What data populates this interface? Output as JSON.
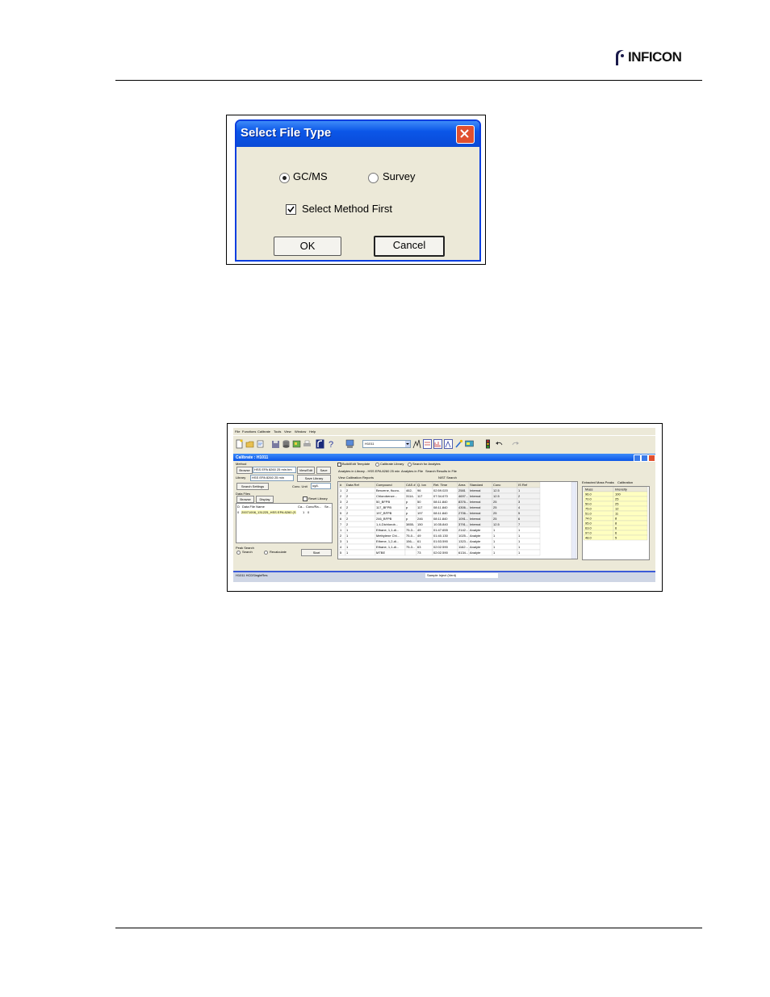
{
  "header": {
    "logo_text": "INFICON"
  },
  "select_file_type_dialog": {
    "title": "Select File Type",
    "options": [
      {
        "label": "GC/MS",
        "selected": true
      },
      {
        "label": "Survey",
        "selected": false
      }
    ],
    "checkbox": {
      "label": "Select Method First",
      "checked": true
    },
    "ok_label": "OK",
    "cancel_label": "Cancel"
  },
  "calibrate_window": {
    "menu": [
      "File",
      "Functions",
      "Calibrate",
      "Tools",
      "View",
      "Window",
      "Help"
    ],
    "toolbar_combo": "H1011",
    "title": "Calibrate : H1011",
    "method_label": "Method",
    "browse_label": "Browse",
    "method_value": "HSS EPA 8260 25 min.hm",
    "view_edit_label": "View/Edit",
    "save_label": "Save",
    "library_label": "Library",
    "library_value": "HSS EPA 8260 25 min",
    "save_library_label": "Save Library",
    "search_settings_label": "Search Settings",
    "conc_unit_label": "Conc. Unit",
    "conc_unit_value": "ug/L",
    "data_files_label": "Data Files",
    "browse2_label": "Browse",
    "display_label": "Display",
    "reset_library_label": "Reset Library",
    "file_columns": [
      "D",
      "Data File Name",
      "Ca...",
      "Conc/Ra...",
      "Se..."
    ],
    "file_row": {
      "d": "0",
      "name": "20071008_131225_HSS EPA 8260 (S",
      "ca": "1",
      "conc": "0"
    },
    "peak_search_label": "Peak Search",
    "search_label": "Search",
    "recalculate_label": "Recalculate",
    "start_label": "Start",
    "top_checks": [
      "Build/Edit Template",
      "Calibrate Library",
      "Search for Analytes"
    ],
    "tabs_row1": [
      "Analytes in Library - HSS EPA 8260 25 min",
      "Analytes in File",
      "Search Results in File"
    ],
    "tabs_row2": [
      "View Calibration Reports",
      "NIST Search"
    ],
    "grid_columns": [
      "#",
      "Data Ref",
      "Compound",
      "CAS #",
      "Q. Ion",
      "Ret. Time",
      "Area",
      "Standard",
      "Conc",
      "IS Ref"
    ],
    "grid_rows": [
      [
        "1",
        "2",
        "Benzene, fluoro-",
        "462-",
        "96",
        "02:59.020",
        "2581",
        "Internal",
        "12.5",
        "1"
      ],
      [
        "2",
        "2",
        "Chlorobenze...",
        "3114-",
        "117",
        "07:34.670",
        "4697...",
        "Internal",
        "12.5",
        "2"
      ],
      [
        "3",
        "2",
        "50_BFPB",
        "p",
        "50",
        "08:11.840",
        "8376...",
        "Internal",
        "25",
        "3"
      ],
      [
        "4",
        "2",
        "117_BFPB",
        "p",
        "117",
        "08:11.840",
        "4306...",
        "Internal",
        "25",
        "4"
      ],
      [
        "5",
        "2",
        "197_BFPB",
        "p",
        "197",
        "08:11.840",
        "2706...",
        "Internal",
        "25",
        "5"
      ],
      [
        "6",
        "2",
        "246_BFPB",
        "p",
        "246",
        "08:11.840",
        "1091...",
        "Internal",
        "25",
        "6"
      ],
      [
        "7",
        "2",
        "1,4-Dichlorob...",
        "3855-",
        "150",
        "10:35.840",
        "3791...",
        "Internal",
        "12.5",
        "7"
      ],
      [
        "1",
        "1",
        "Ethane, 1,1-di...",
        "75-3...",
        "49",
        "01:47.655",
        "2142...",
        "Analyte",
        "1",
        "1"
      ],
      [
        "2",
        "1",
        "Methylene Chl...",
        "75-0...",
        "49",
        "01:40.130",
        "1025...",
        "Analyte",
        "1",
        "1"
      ],
      [
        "3",
        "1",
        "Ethene, 1,2-di...",
        "156-...",
        "61",
        "01:53.590",
        "1323...",
        "Analyte",
        "1",
        "1"
      ],
      [
        "4",
        "1",
        "Ethane, 1,1-di...",
        "75-3...",
        "63",
        "02:02.590",
        "1162...",
        "Analyte",
        "1",
        "1"
      ],
      [
        "5",
        "1",
        "MTBE",
        "",
        "73",
        "02:02.590",
        "6134...",
        "Analyte",
        "1",
        "1"
      ]
    ],
    "ms_tabs": [
      "Extracted Mass Peaks",
      "Calibration"
    ],
    "ms_columns": [
      "Mass",
      "Intensity"
    ],
    "ms_rows": [
      [
        "96.0",
        "100"
      ],
      [
        "70.0",
        "25"
      ],
      [
        "50.0",
        "25"
      ],
      [
        "75.0",
        "12"
      ],
      [
        "51.0",
        "11"
      ],
      [
        "74.0",
        "8"
      ],
      [
        "95.0",
        "8"
      ],
      [
        "63.0",
        "6"
      ],
      [
        "97.0",
        "6"
      ],
      [
        "48.0",
        "5"
      ]
    ],
    "status_left": "H1011 HCDSingleRes",
    "status_mid": "Sample Inject (Vent)"
  }
}
